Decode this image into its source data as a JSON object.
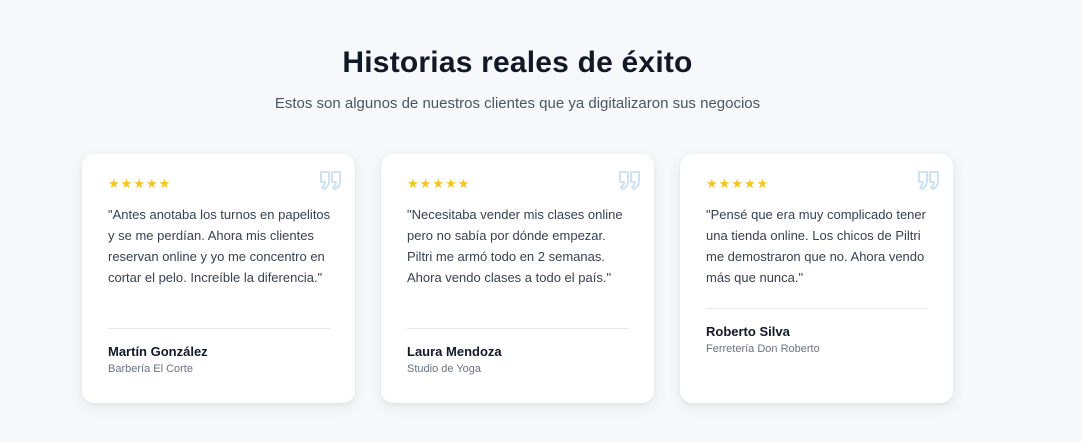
{
  "section": {
    "title": "Historias reales de éxito",
    "subtitle": "Estos son algunos de nuestros clientes que ya digitalizaron sus negocios"
  },
  "colors": {
    "star": "#f5c518",
    "quote_icon": "#c9dff3",
    "background": "#f6f8fb"
  },
  "testimonials": [
    {
      "rating": 5,
      "stars": "★★★★★",
      "quote": "\"Antes anotaba los turnos en papelitos y se me perdían. Ahora mis clientes reservan online y yo me concentro en cortar el pelo. Increíble la diferencia.\"",
      "name": "Martín González",
      "company": "Barbería El Corte"
    },
    {
      "rating": 5,
      "stars": "★★★★★",
      "quote": "\"Necesitaba vender mis clases online pero no sabía por dónde empezar. Piltri me armó todo en 2 semanas. Ahora vendo clases a todo el país.\"",
      "name": "Laura Mendoza",
      "company": "Studio de Yoga"
    },
    {
      "rating": 5,
      "stars": "★★★★★",
      "quote": "\"Pensé que era muy complicado tener una tienda online. Los chicos de Piltri me demostraron que no. Ahora vendo más que nunca.\"",
      "name": "Roberto Silva",
      "company": "Ferretería Don Roberto"
    }
  ]
}
